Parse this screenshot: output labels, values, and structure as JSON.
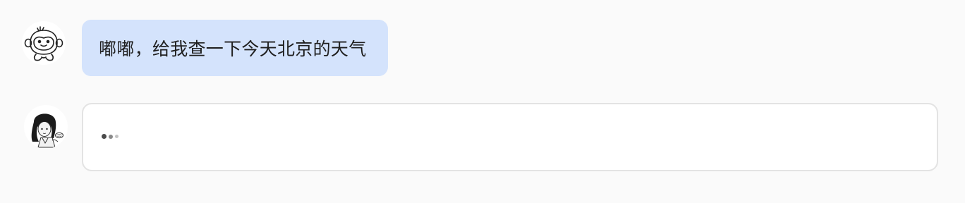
{
  "conversation": {
    "user_message": {
      "avatar_icon": "monkey-icon",
      "text": "嘟嘟，给我查一下今天北京的天气",
      "bubble_color": "#d4e3fc"
    },
    "assistant_message": {
      "avatar_icon": "girl-portrait-icon",
      "status": "typing",
      "typing_indicator_icon": "typing-dots-icon"
    }
  }
}
